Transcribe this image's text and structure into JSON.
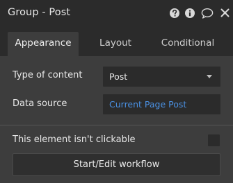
{
  "header": {
    "title": "Group - Post",
    "icons": [
      "help-icon",
      "info-icon",
      "comment-icon",
      "close-icon"
    ]
  },
  "tabs": [
    {
      "label": "Appearance",
      "active": true
    },
    {
      "label": "Layout",
      "active": false
    },
    {
      "label": "Conditional",
      "active": false
    }
  ],
  "appearance": {
    "type_of_content": {
      "label": "Type of content",
      "value": "Post"
    },
    "data_source": {
      "label": "Data source",
      "value": "Current Page Post"
    },
    "not_clickable": {
      "label": "This element isn't clickable",
      "checked": false
    },
    "workflow_button": "Start/Edit workflow"
  },
  "colors": {
    "background": "#3d3d3d",
    "header_background": "#2b2b2b",
    "field_background": "#2b2b2b",
    "link": "#4a90e2",
    "text": "#e8e8e8"
  }
}
